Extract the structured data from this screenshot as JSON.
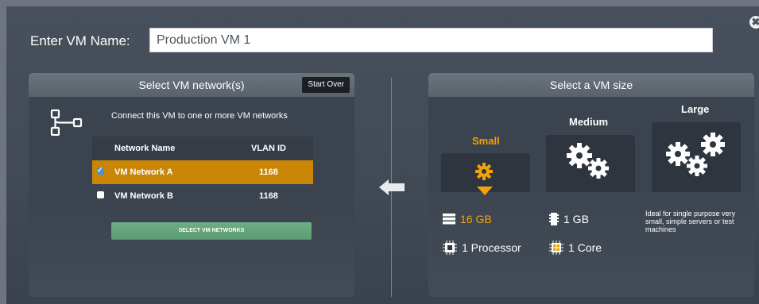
{
  "dialog": {
    "name_label": "Enter VM Name:",
    "name_value": "Production VM 1",
    "close_glyph": "✖"
  },
  "network_panel": {
    "title": "Select VM network(s)",
    "start_over": "Start Over",
    "instruction": "Connect this VM to one or more VM networks",
    "columns": [
      "Network Name",
      "VLAN ID"
    ],
    "rows": [
      {
        "name": "VM Network A",
        "vlan": "1168",
        "checked": true
      },
      {
        "name": "VM Network B",
        "vlan": "1168",
        "checked": false
      }
    ],
    "select_button": "SELECT VM NETWORKS"
  },
  "size_panel": {
    "title": "Select a VM size",
    "sizes": [
      {
        "label": "Small",
        "selected": true
      },
      {
        "label": "Medium",
        "selected": false
      },
      {
        "label": "Large",
        "selected": false
      }
    ],
    "specs": {
      "storage": "16 GB",
      "memory": "1 GB",
      "processor": "1 Processor",
      "cores": "1 Core"
    },
    "large_description": "Ideal for single purpose very small, simple servers or test machines"
  },
  "colors": {
    "accent": "#f0a30a",
    "selected_row": "#c98607",
    "button_green": "#66a47b",
    "panel_bg": "#3b434e"
  },
  "icons": {
    "network": "network-branch-icon",
    "arrow": "arrow-left-icon",
    "small_gear": "gear-icon",
    "medium_gears": "two-gears-icon",
    "large_gears": "three-gears-icon",
    "storage": "storage-icon",
    "memory": "memory-chip-icon",
    "processor": "processor-icon",
    "cores": "cores-icon"
  }
}
